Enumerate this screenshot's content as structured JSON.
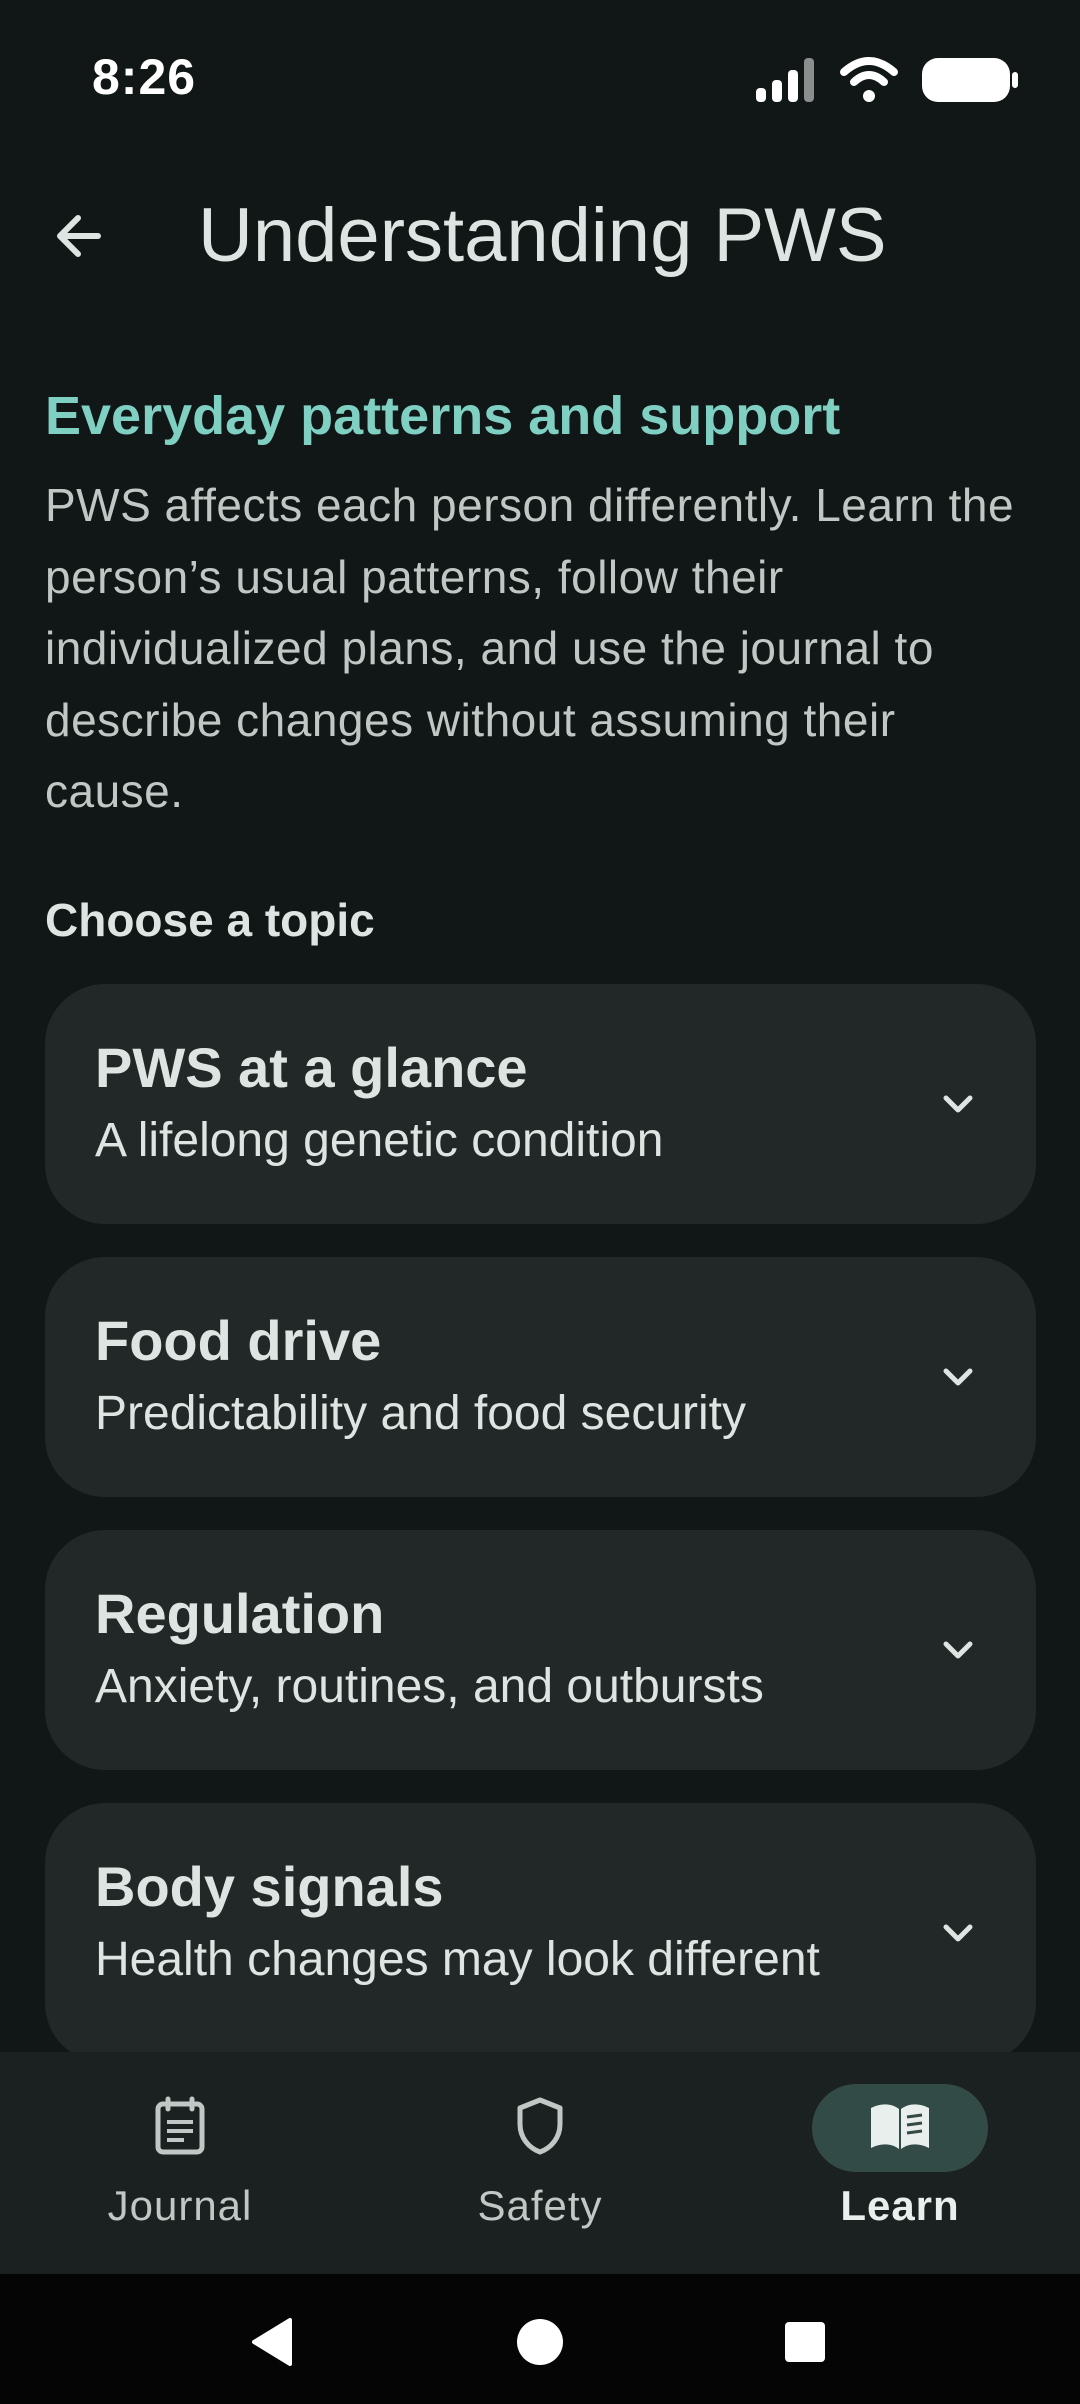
{
  "status_bar": {
    "time": "8:26",
    "icons": [
      "signal-icon",
      "wifi-icon",
      "battery-icon"
    ]
  },
  "app_bar": {
    "back_icon": "arrow-back-icon",
    "title": "Understanding PWS"
  },
  "content": {
    "section_heading": "Everyday patterns and support",
    "intro": "PWS affects each person differently. Learn the person’s usual patterns, follow their individualized plans, and use the journal to describe changes without assuming their cause.",
    "choose_label": "Choose a topic",
    "topics": [
      {
        "title": "PWS at a glance",
        "subtitle": "A lifelong genetic condition",
        "icon": "chevron-down-icon"
      },
      {
        "title": "Food drive",
        "subtitle": "Predictability and food security",
        "icon": "chevron-down-icon"
      },
      {
        "title": "Regulation",
        "subtitle": "Anxiety, routines, and outbursts",
        "icon": "chevron-down-icon"
      },
      {
        "title": "Body signals",
        "subtitle": "Health changes may look different",
        "icon": "chevron-down-icon"
      }
    ]
  },
  "bottom_nav": {
    "items": [
      {
        "label": "Journal",
        "icon": "journal-icon",
        "active": false
      },
      {
        "label": "Safety",
        "icon": "shield-icon",
        "active": false
      },
      {
        "label": "Learn",
        "icon": "book-icon",
        "active": true
      }
    ]
  },
  "colors": {
    "background": "#111716",
    "accent": "#7fcfc3",
    "card": "#212827",
    "nav_background": "#1b2120",
    "active_pill": "#334b47"
  },
  "system_nav": {
    "buttons": [
      "back-triangle-icon",
      "home-circle-icon",
      "recents-square-icon"
    ]
  }
}
